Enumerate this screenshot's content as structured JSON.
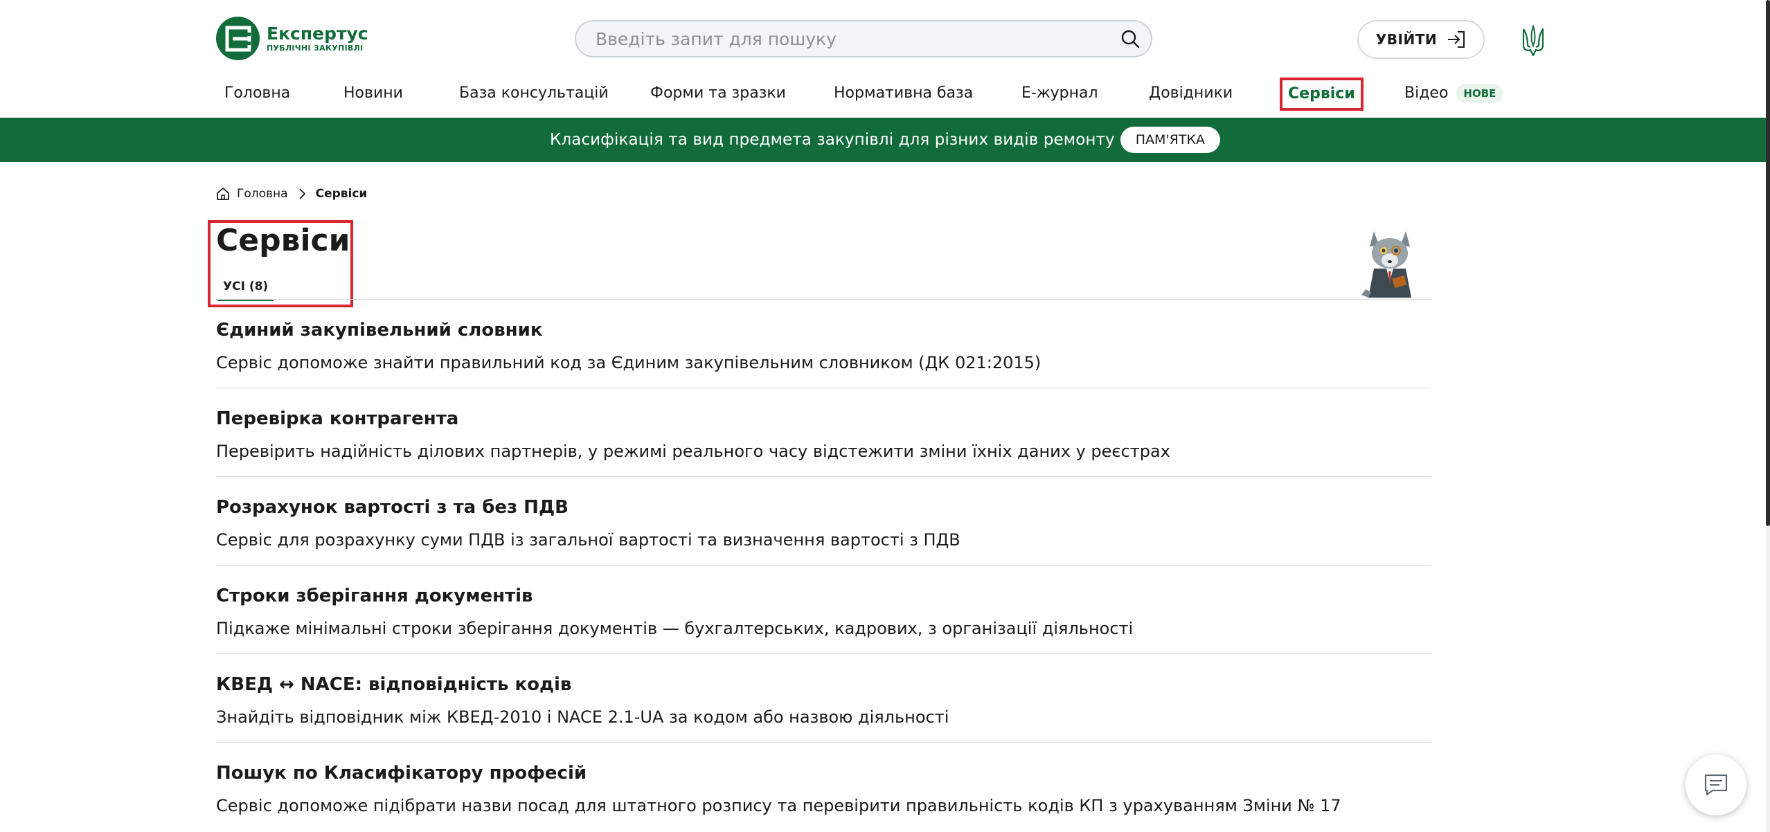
{
  "brand": {
    "name": "Експертус",
    "subtitle": "ПУБЛІЧНІ ЗАКУПІВЛІ",
    "color": "#116b3a"
  },
  "search": {
    "placeholder": "Введіть запит для пошуку"
  },
  "header": {
    "login_label": "УВІЙТИ"
  },
  "nav": {
    "items": [
      {
        "label": "Головна"
      },
      {
        "label": "Новини"
      },
      {
        "label": "База консультацій"
      },
      {
        "label": "Форми та зразки"
      },
      {
        "label": "Нормативна база"
      },
      {
        "label": "Е-журнал"
      },
      {
        "label": "Довідники"
      },
      {
        "label": "Сервіси",
        "active": true
      },
      {
        "label": "Відео",
        "badge": "НОВЕ"
      }
    ]
  },
  "banner": {
    "text": "Класифікація та вид предмета закупівлі для різних видів ремонту",
    "button_label": "ПАМ'ЯТКА"
  },
  "breadcrumb": {
    "home": "Головна",
    "current": "Сервіси"
  },
  "page": {
    "title": "Сервіси",
    "tab_all": "УСІ (8)"
  },
  "services": [
    {
      "title": "Єдиний закупівельний словник",
      "description": "Сервіс допоможе знайти правильний код за Єдиним закупівельним словником (ДК 021:2015)"
    },
    {
      "title": "Перевірка контрагента",
      "description": "Перевірить надійність ділових партнерів, у режимі реального часу відстежити зміни їхніх даних у реєстрах"
    },
    {
      "title": "Розрахунок вартості з та без ПДВ",
      "description": "Сервіс для розрахунку суми ПДВ із загальної вартості та визначення вартості з ПДВ"
    },
    {
      "title": "Строки зберігання документів",
      "description": "Підкаже мінімальні строки зберігання документів — бухгалтерських, кадрових, з організації діяльності"
    },
    {
      "title": "КВЕД ↔ NACE: відповідність кодів",
      "description": "Знайдіть відповідник між КВЕД-2010 і NACE 2.1-UA за кодом або назвою діяльності"
    },
    {
      "title": "Пошук по Класифікатору професій",
      "description": "Сервіс допоможе підібрати назви посад для штатного розпису та перевірити правильність кодів КП з урахуванням Зміни № 17"
    }
  ],
  "colors": {
    "accent": "#116b3a",
    "highlight": "#d72630"
  }
}
